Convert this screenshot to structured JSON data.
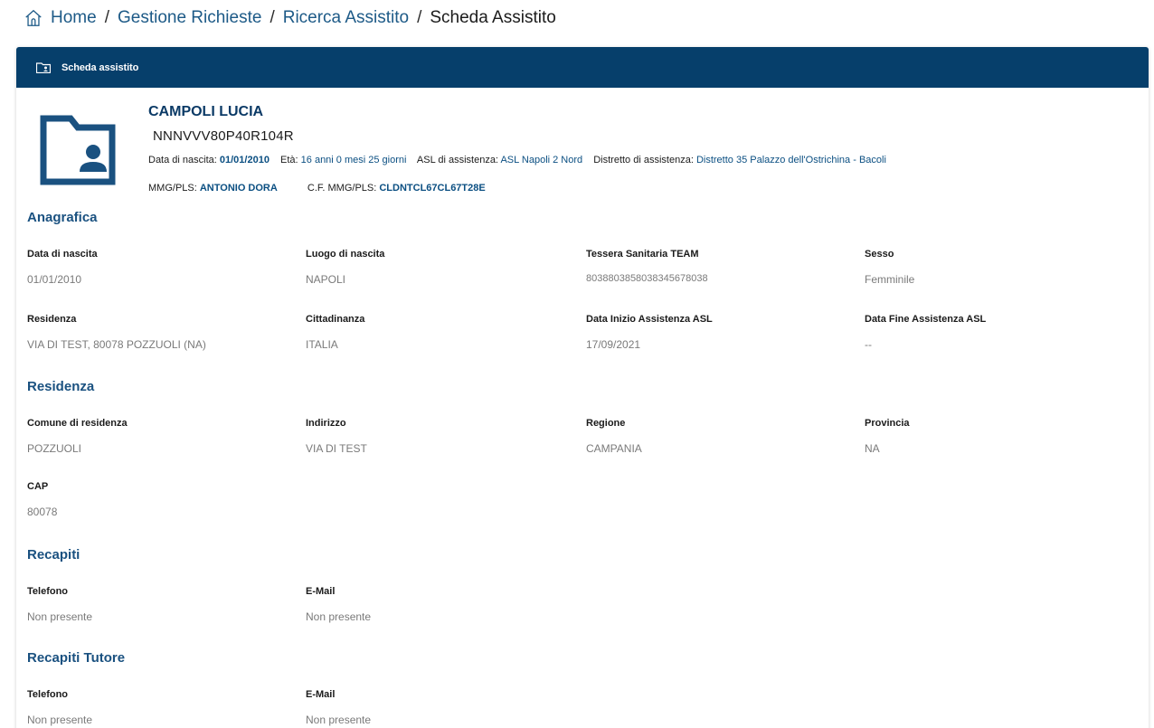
{
  "breadcrumb": {
    "items": [
      "Home",
      "Gestione Richieste",
      "Ricerca Assistito"
    ],
    "separator": "/",
    "current": "Scheda Assistito"
  },
  "card": {
    "title": "Scheda assistito"
  },
  "patient": {
    "name": "CAMPOLI LUCIA",
    "codice_fiscale": "NNNVVV80P40R104R",
    "info": {
      "birth_label": "Data di nascita:",
      "birth_value": "01/01/2010",
      "age_label": "Età:",
      "age_value": "16 anni 0 mesi 25 giorni",
      "asl_label": "ASL di assistenza:",
      "asl_value": "ASL Napoli 2 Nord",
      "district_label": "Distretto di assistenza:",
      "district_value": "Distretto 35 Palazzo dell'Ostrichina - Bacoli",
      "mmg_label": "MMG/PLS:",
      "mmg_value": "ANTONIO DORA",
      "cf_mmg_label": "C.F. MMG/PLS:",
      "cf_mmg_value": "CLDNTCL67CL67T28E"
    }
  },
  "sections": {
    "anagrafica": {
      "title": "Anagrafica",
      "fields": [
        {
          "label": "Data di nascita",
          "value": "01/01/2010"
        },
        {
          "label": "Luogo di nascita",
          "value": "NAPOLI"
        },
        {
          "label": "Tessera Sanitaria TEAM",
          "value": "80388038580383456780​38"
        },
        {
          "label": "Sesso",
          "value": "Femminile"
        },
        {
          "label": "Residenza",
          "value": "VIA DI TEST, 80078 POZZUOLI (NA)"
        },
        {
          "label": "Cittadinanza",
          "value": "ITALIA"
        },
        {
          "label": "Data Inizio Assistenza ASL",
          "value": "17/09/2021"
        },
        {
          "label": "Data Fine Assistenza ASL",
          "value": "--"
        }
      ]
    },
    "residenza": {
      "title": "Residenza",
      "fields": [
        {
          "label": "Comune di residenza",
          "value": "POZZUOLI"
        },
        {
          "label": "Indirizzo",
          "value": "VIA DI TEST"
        },
        {
          "label": "Regione",
          "value": "CAMPANIA"
        },
        {
          "label": "Provincia",
          "value": "NA"
        },
        {
          "label": "CAP",
          "value": "80078"
        }
      ]
    },
    "recapiti": {
      "title": "Recapiti",
      "fields": [
        {
          "label": "Telefono",
          "value": "Non presente"
        },
        {
          "label": "E-Mail",
          "value": "Non presente"
        }
      ]
    },
    "recapiti_tutore": {
      "title": "Recapiti Tutore",
      "fields": [
        {
          "label": "Telefono",
          "value": "Non presente"
        },
        {
          "label": "E-Mail",
          "value": "Non presente"
        }
      ]
    }
  },
  "colors": {
    "header_bg": "#063f6b",
    "link": "#1d5a87",
    "section_title": "#1a5180",
    "value_grey": "#7a7a7a"
  }
}
